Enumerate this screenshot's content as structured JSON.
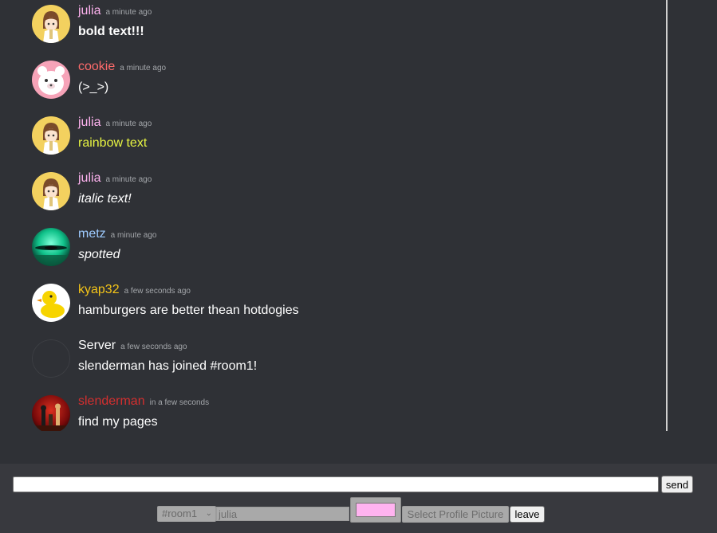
{
  "messages": [
    {
      "username": "julia",
      "name_color": "#ffb3f0",
      "time": "a minute ago",
      "text": "bold text!!!",
      "style": "bold",
      "text_color": "#ffffff",
      "avatar": "anime-girl-avatar"
    },
    {
      "username": "cookie",
      "name_color": "#ff6b6b",
      "time": "a minute ago",
      "text": "(>_>)",
      "style": "normal",
      "text_color": "#ffffff",
      "avatar": "bear-avatar"
    },
    {
      "username": "julia",
      "name_color": "#ffb3f0",
      "time": "a minute ago",
      "text": "rainbow text",
      "style": "normal",
      "text_color": "#e8f542",
      "avatar": "anime-girl-avatar"
    },
    {
      "username": "julia",
      "name_color": "#ffb3f0",
      "time": "a minute ago",
      "text": "italic text!",
      "style": "italic",
      "text_color": "#ffffff",
      "avatar": "anime-girl-avatar"
    },
    {
      "username": "metz",
      "name_color": "#9ecbff",
      "time": "a minute ago",
      "text": "spotted",
      "style": "italic",
      "text_color": "#ffffff",
      "avatar": "green-orb-avatar"
    },
    {
      "username": "kyap32",
      "name_color": "#f5c518",
      "time": "a few seconds ago",
      "text": "hamburgers are better thean hotdogies",
      "style": "normal",
      "text_color": "#ffffff",
      "avatar": "rubber-duck-avatar"
    },
    {
      "username": "Server",
      "name_color": "#ffffff",
      "time": "a few seconds ago",
      "text": "slenderman has joined #room1!",
      "style": "normal",
      "text_color": "#ffffff",
      "avatar": "server-avatar"
    },
    {
      "username": "slenderman",
      "name_color": "#d32f2f",
      "time": "in a few seconds",
      "text": "find my pages",
      "style": "normal",
      "text_color": "#ffffff",
      "avatar": "chess-avatar"
    }
  ],
  "composer": {
    "message_value": "",
    "send_label": "send"
  },
  "settings": {
    "room": "#room1",
    "name_value": "julia",
    "color": "#ffb3f0",
    "pfp_label": "Select Profile Picture",
    "leave_label": "leave"
  }
}
